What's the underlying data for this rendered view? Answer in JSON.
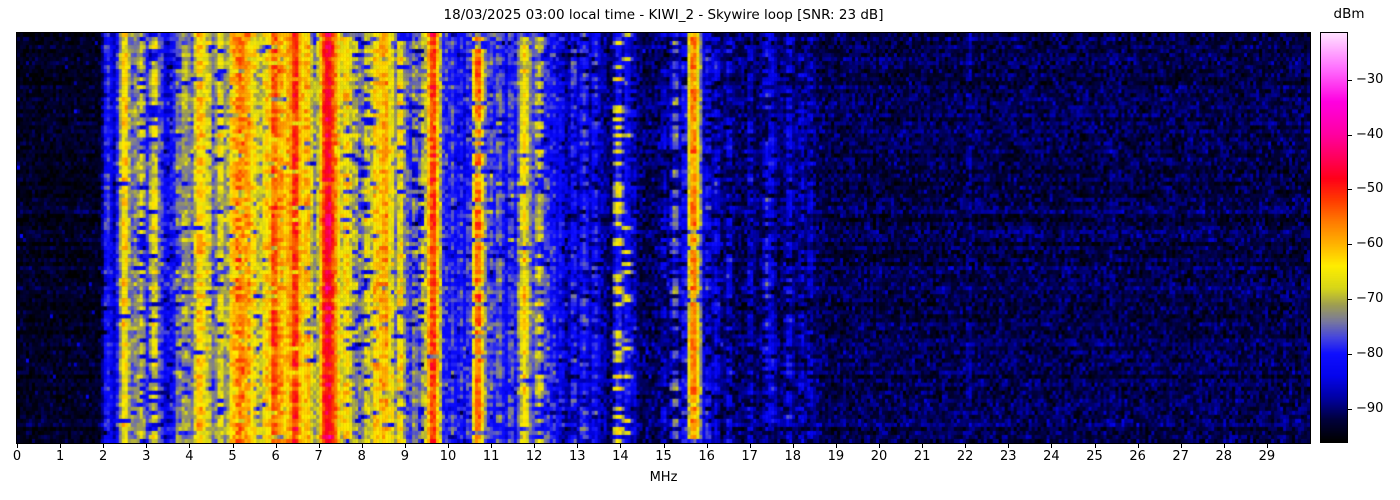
{
  "figure": {
    "title": "18/03/2025 03:00 local time - KIWI_2 - Skywire loop [SNR: 23 dB]"
  },
  "x_axis": {
    "label": "MHz",
    "ticks": [
      0,
      1,
      2,
      3,
      4,
      5,
      6,
      7,
      8,
      9,
      10,
      11,
      12,
      13,
      14,
      15,
      16,
      17,
      18,
      19,
      20,
      21,
      22,
      23,
      24,
      25,
      26,
      27,
      28,
      29
    ],
    "range_mhz": [
      0,
      30
    ]
  },
  "colorbar": {
    "label": "dBm",
    "ticks": [
      -30,
      -40,
      -50,
      -60,
      -70,
      -80,
      -90
    ],
    "vmax": -21.5,
    "vmin": -96,
    "colormap_stops": [
      [
        -96,
        "#000000"
      ],
      [
        -92,
        "#00003c"
      ],
      [
        -88,
        "#0000a5"
      ],
      [
        -84,
        "#0505ee"
      ],
      [
        -80,
        "#0f0fff"
      ],
      [
        -77,
        "#4646de"
      ],
      [
        -74,
        "#7a7a9b"
      ],
      [
        -71,
        "#a0a050"
      ],
      [
        -68,
        "#d7d719"
      ],
      [
        -64,
        "#ffee00"
      ],
      [
        -60,
        "#ffb400"
      ],
      [
        -56,
        "#ff7d00"
      ],
      [
        -52,
        "#ff3c00"
      ],
      [
        -48,
        "#ff0019"
      ],
      [
        -44,
        "#ff005f"
      ],
      [
        -40,
        "#ff00a0"
      ],
      [
        -34,
        "#ff00e1"
      ],
      [
        -28,
        "#ff6eff"
      ],
      [
        -21.5,
        "#ffe1ff"
      ]
    ]
  },
  "chart_data": {
    "type": "heatmap",
    "subtype": "radio-spectrum-waterfall",
    "title": "18/03/2025 03:00 local time - KIWI_2 - Skywire loop [SNR: 23 dB]",
    "xlabel": "MHz",
    "x_range_mhz": [
      0,
      30
    ],
    "y_axis": "time (waterfall rows, unlabeled)",
    "value_units": "dBm",
    "value_range_dbm": [
      -96,
      -21.5
    ],
    "snr_db": 23,
    "noise_regions": [
      {
        "from_mhz": 0.0,
        "to_mhz": 2.05,
        "mean_dbm": -93.5,
        "sd_db": 1.6
      },
      {
        "from_mhz": 2.05,
        "to_mhz": 9.0,
        "mean_dbm": -89.0,
        "sd_db": 3.2
      },
      {
        "from_mhz": 9.0,
        "to_mhz": 9.6,
        "mean_dbm": -87.5,
        "sd_db": 3.0
      },
      {
        "from_mhz": 9.6,
        "to_mhz": 12.65,
        "mean_dbm": -85.5,
        "sd_db": 3.2
      },
      {
        "from_mhz": 12.65,
        "to_mhz": 13.65,
        "mean_dbm": -88.0,
        "sd_db": 2.8
      },
      {
        "from_mhz": 13.65,
        "to_mhz": 18.7,
        "mean_dbm": -90.5,
        "sd_db": 2.4
      },
      {
        "from_mhz": 18.7,
        "to_mhz": 30.0,
        "mean_dbm": -91.3,
        "sd_db": 2.2
      }
    ],
    "band_format": [
      "center_mhz",
      "half_width_mhz",
      "peak_level_dbm",
      "duty_cycle"
    ],
    "signal_bands": [
      [
        2.1,
        0.035,
        -79,
        0.95
      ],
      [
        2.18,
        0.03,
        -83,
        0.9
      ],
      [
        2.32,
        0.03,
        -84,
        0.8
      ],
      [
        2.5,
        0.045,
        -64,
        0.97
      ],
      [
        2.62,
        0.035,
        -77,
        0.85
      ],
      [
        2.74,
        0.05,
        -73,
        0.9
      ],
      [
        2.88,
        0.04,
        -69,
        0.75
      ],
      [
        3.02,
        0.04,
        -80,
        0.85
      ],
      [
        3.18,
        0.05,
        -67,
        0.8
      ],
      [
        3.32,
        0.04,
        -76,
        0.85
      ],
      [
        3.48,
        0.03,
        -82,
        0.7
      ],
      [
        3.62,
        0.04,
        -80,
        0.8
      ],
      [
        3.76,
        0.05,
        -74,
        0.9
      ],
      [
        3.92,
        0.06,
        -71,
        0.9
      ],
      [
        4.06,
        0.05,
        -75,
        0.85
      ],
      [
        4.25,
        0.07,
        -62,
        0.97
      ],
      [
        4.42,
        0.05,
        -68,
        0.9
      ],
      [
        4.58,
        0.04,
        -75,
        0.8
      ],
      [
        4.72,
        0.05,
        -67,
        0.85
      ],
      [
        4.88,
        0.05,
        -72,
        0.85
      ],
      [
        5.04,
        0.06,
        -61,
        0.95
      ],
      [
        5.13,
        0.04,
        -55,
        0.55
      ],
      [
        5.22,
        0.06,
        -57,
        0.9
      ],
      [
        5.36,
        0.05,
        -59,
        0.9
      ],
      [
        5.5,
        0.04,
        -64,
        0.85
      ],
      [
        5.64,
        0.05,
        -69,
        0.8
      ],
      [
        5.8,
        0.05,
        -63,
        0.9
      ],
      [
        5.98,
        0.05,
        -54,
        0.9
      ],
      [
        6.12,
        0.06,
        -59,
        0.9
      ],
      [
        6.3,
        0.06,
        -60,
        0.9
      ],
      [
        6.45,
        0.04,
        -51,
        0.95
      ],
      [
        6.56,
        0.05,
        -62,
        0.9
      ],
      [
        6.72,
        0.06,
        -61,
        0.9
      ],
      [
        6.86,
        0.04,
        -70,
        0.8
      ],
      [
        7.02,
        0.04,
        -73,
        0.8
      ],
      [
        7.22,
        0.07,
        -47,
        1.0
      ],
      [
        7.36,
        0.05,
        -57,
        0.9
      ],
      [
        7.52,
        0.04,
        -67,
        0.85
      ],
      [
        7.66,
        0.05,
        -63,
        0.8
      ],
      [
        7.82,
        0.05,
        -70,
        0.8
      ],
      [
        7.96,
        0.04,
        -74,
        0.75
      ],
      [
        8.12,
        0.05,
        -68,
        0.8
      ],
      [
        8.34,
        0.06,
        -62,
        0.9
      ],
      [
        8.52,
        0.07,
        -60,
        0.95
      ],
      [
        8.68,
        0.05,
        -66,
        0.85
      ],
      [
        8.9,
        0.03,
        -65,
        0.9
      ],
      [
        9.06,
        0.05,
        -76,
        0.85
      ],
      [
        9.22,
        0.04,
        -73,
        0.8
      ],
      [
        9.42,
        0.04,
        -70,
        0.75
      ],
      [
        9.65,
        0.035,
        -52,
        0.97
      ],
      [
        9.82,
        0.05,
        -75,
        0.8
      ],
      [
        9.95,
        0.04,
        -79,
        0.9
      ],
      [
        10.1,
        0.04,
        -77,
        0.9
      ],
      [
        10.3,
        0.04,
        -79,
        0.85
      ],
      [
        10.48,
        0.04,
        -78,
        0.85
      ],
      [
        10.7,
        0.035,
        -55,
        0.8
      ],
      [
        10.82,
        0.04,
        -77,
        0.85
      ],
      [
        11.0,
        0.05,
        -76,
        0.9
      ],
      [
        11.2,
        0.05,
        -75,
        0.85
      ],
      [
        11.45,
        0.05,
        -77,
        0.85
      ],
      [
        11.65,
        0.04,
        -75,
        0.8
      ],
      [
        11.77,
        0.03,
        -63,
        0.95
      ],
      [
        11.9,
        0.05,
        -74,
        0.9
      ],
      [
        12.05,
        0.05,
        -76,
        0.85
      ],
      [
        12.12,
        0.04,
        -67,
        0.6
      ],
      [
        12.3,
        0.04,
        -78,
        0.8
      ],
      [
        12.45,
        0.04,
        -79,
        0.8
      ],
      [
        12.62,
        0.04,
        -82,
        0.7
      ],
      [
        12.92,
        0.04,
        -80,
        0.7
      ],
      [
        13.16,
        0.05,
        -78,
        0.75
      ],
      [
        13.42,
        0.04,
        -80,
        0.7
      ],
      [
        13.95,
        0.03,
        -64,
        0.35
      ],
      [
        14.15,
        0.03,
        -66,
        0.15
      ],
      [
        14.32,
        0.03,
        -84,
        0.6
      ],
      [
        15.02,
        0.03,
        -85,
        0.5
      ],
      [
        15.27,
        0.025,
        -74,
        0.5
      ],
      [
        15.5,
        0.03,
        -80,
        0.7
      ],
      [
        15.7,
        0.03,
        -57,
        0.98
      ],
      [
        15.85,
        0.03,
        -79,
        0.8
      ],
      [
        16.02,
        0.03,
        -81,
        0.6
      ],
      [
        16.22,
        0.04,
        -83,
        0.7
      ],
      [
        16.52,
        0.04,
        -84,
        0.6
      ],
      [
        17.02,
        0.03,
        -85,
        0.6
      ],
      [
        17.4,
        0.03,
        -80,
        0.5
      ],
      [
        17.52,
        0.05,
        -83,
        0.7
      ],
      [
        17.92,
        0.05,
        -83,
        0.7
      ],
      [
        18.22,
        0.04,
        -84,
        0.6
      ],
      [
        18.42,
        0.03,
        -85,
        0.6
      ],
      [
        22.1,
        0.025,
        -88,
        0.6
      ],
      [
        25.4,
        0.02,
        -90,
        0.5
      ]
    ],
    "legend": "none",
    "grid": "off"
  },
  "render": {
    "seed": 20250318,
    "rows": 102,
    "cols": 432
  }
}
